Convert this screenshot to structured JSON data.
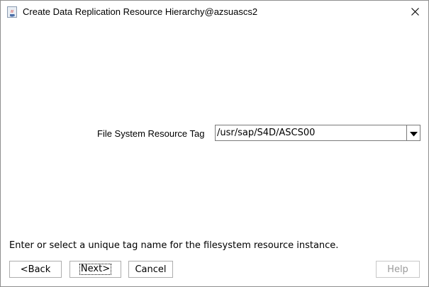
{
  "window": {
    "title": "Create Data Replication Resource Hierarchy@azsuascs2",
    "icon": "java-cup-icon",
    "close_icon": "close-icon"
  },
  "form": {
    "label": "File System Resource Tag",
    "tag_value": "/usr/sap/S4D/ASCS00",
    "dropdown_icon": "chevron-down-icon"
  },
  "hint": "Enter or select a unique tag name for the filesystem resource instance.",
  "buttons": {
    "back": "<Back",
    "next": "Next>",
    "cancel": "Cancel",
    "help": "Help"
  },
  "colors": {
    "background": "#ffffff",
    "disabled_text": "#9a9a9a",
    "border": "#7a7a7a"
  }
}
